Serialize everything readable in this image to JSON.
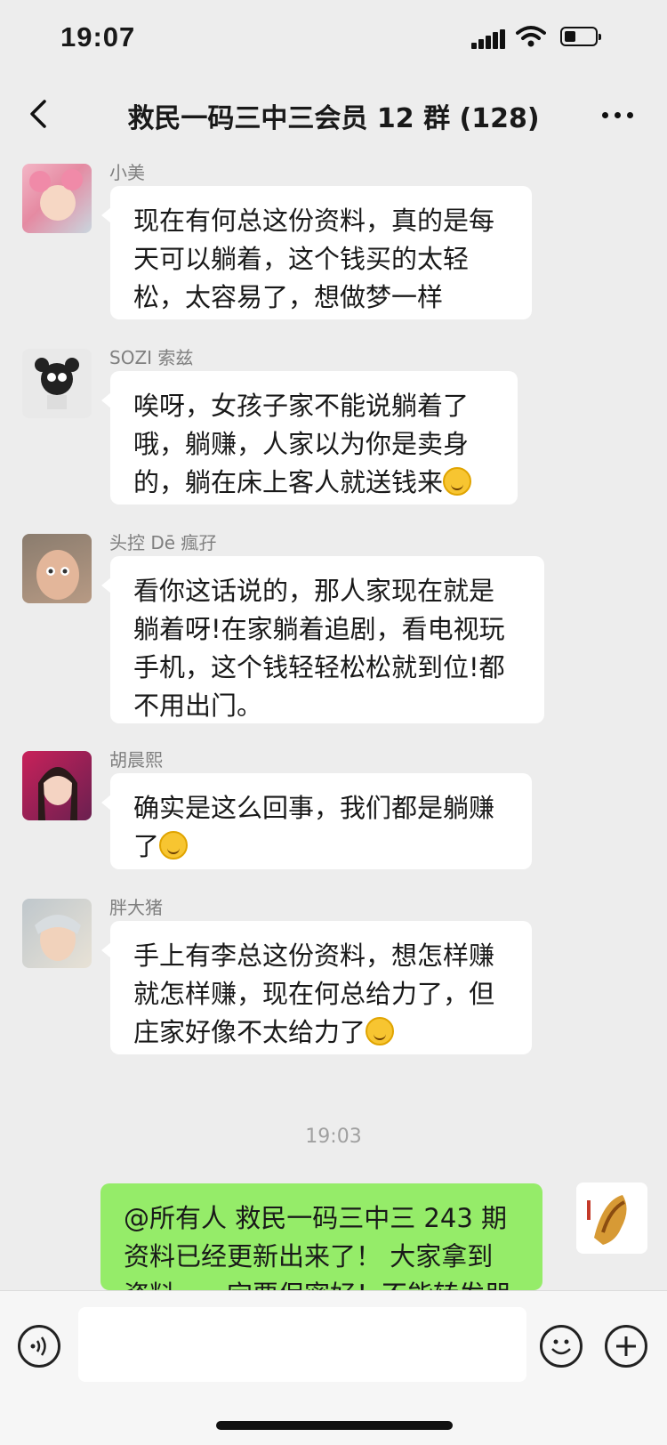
{
  "status_bar": {
    "time": "19:07"
  },
  "header": {
    "title": "救民一码三中三会员 12 群 (128)"
  },
  "icons": {
    "back": "chevron-left-icon",
    "more": "more-dots-icon",
    "voice": "voice-icon",
    "emoji": "emoji-icon",
    "add": "plus-icon"
  },
  "messages": [
    {
      "sender": "小美",
      "lines": [
        "现在有何总这份资料，真的是每",
        "天可以躺着，这个钱买的太轻",
        "松，太容易了，想做梦一样"
      ]
    },
    {
      "sender": "SOZI 索兹",
      "lines": [
        "唉呀，女孩子家不能说躺着了",
        "哦，躺赚，人家以为你是卖身",
        "的，躺在床上客人就送钱来"
      ]
    },
    {
      "sender": "头控 Dē 瘋孖",
      "lines": [
        "看你这话说的，那人家现在就是",
        "躺着呀!在家躺着追剧，看电视玩",
        "手机，这个钱轻轻松松就到位!都",
        "不用出门。"
      ]
    },
    {
      "sender": "胡晨熙",
      "lines": [
        "确实是这么回事，我们都是躺赚",
        "了"
      ]
    },
    {
      "sender": "胖大猪",
      "lines": [
        "手上有李总这份资料，想怎样赚",
        "就怎样赚，现在何总给力了，但",
        "庄家好像不太给力了"
      ]
    }
  ],
  "timestamp": "19:03",
  "outgoing": {
    "lines": [
      "@所有人  救民一码三中三 243 期",
      "资料已经更新出来了！ 大家拿到",
      "资料，一定要保密好！不能转发朋"
    ]
  },
  "input": {
    "placeholder": ""
  },
  "colors": {
    "background": "#ededed",
    "outgoing_bubble": "#95ec69",
    "incoming_bubble": "#ffffff"
  }
}
